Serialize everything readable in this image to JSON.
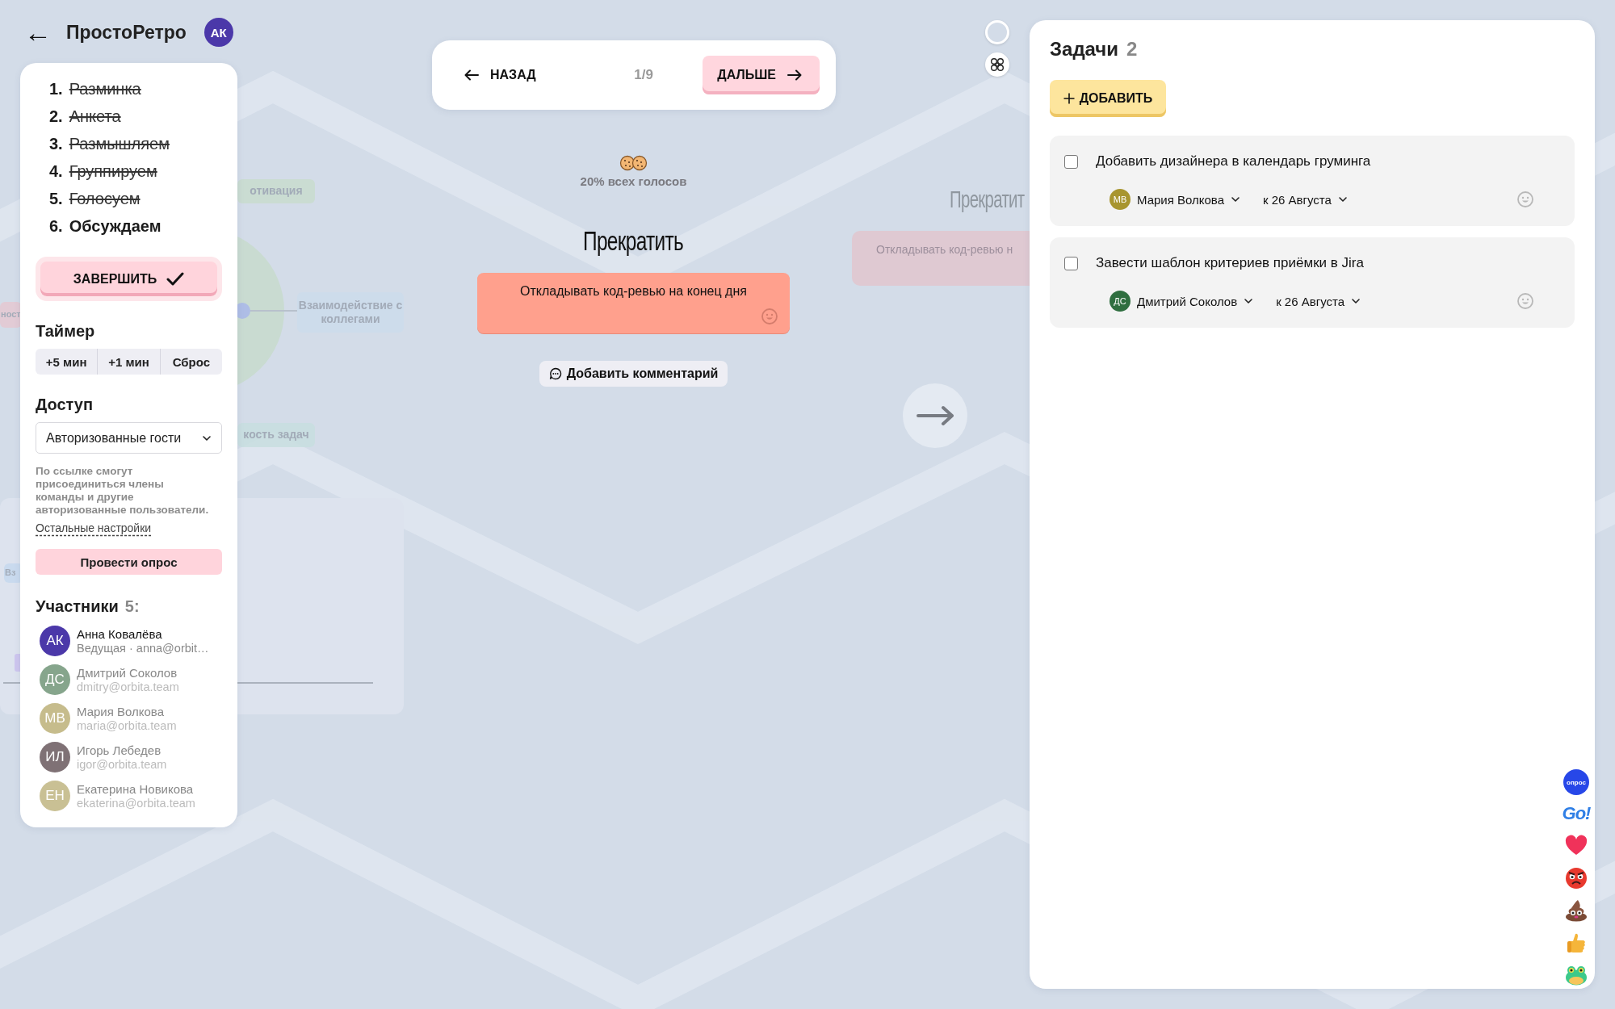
{
  "header": {
    "back_label": "←",
    "title": "ПростоРетро",
    "avatar": "АК"
  },
  "stages": [
    {
      "number": "1.",
      "label": "Разминка",
      "done": true
    },
    {
      "number": "2.",
      "label": "Анкета",
      "done": true
    },
    {
      "number": "3.",
      "label": "Размышляем",
      "done": true
    },
    {
      "number": "4.",
      "label": "Группируем",
      "done": true
    },
    {
      "number": "5.",
      "label": "Голосуем",
      "done": true
    },
    {
      "number": "6.",
      "label": "Обсуждаем",
      "done": false
    }
  ],
  "finish_button": "ЗАВЕРШИТЬ",
  "timer": {
    "title": "Таймер",
    "buttons": [
      "+5 мин",
      "+1 мин",
      "Сброс"
    ]
  },
  "access": {
    "title": "Доступ",
    "value": "Авторизованные гости",
    "hint": "По ссылке смогут присоединиться члены команды и другие авторизованные пользователи.",
    "settings_link": "Остальные настройки"
  },
  "poll_button": "Провести опрос",
  "participants": {
    "title": "Участники",
    "count": "5:",
    "items": [
      {
        "initials": "АК",
        "name": "Анна Ковалёва",
        "detail": "Ведущая · anna@orbit…",
        "color": "#4b38a9",
        "active": true
      },
      {
        "initials": "ДС",
        "name": "Дмитрий Соколов",
        "detail": "dmitry@orbita.team",
        "color": "#86a58c",
        "active": false
      },
      {
        "initials": "МВ",
        "name": "Мария Волкова",
        "detail": "maria@orbita.team",
        "color": "#c6bc8c",
        "active": false
      },
      {
        "initials": "ИЛ",
        "name": "Игорь Лебедев",
        "detail": "igor@orbita.team",
        "color": "#7f7175",
        "active": false
      },
      {
        "initials": "ЕН",
        "name": "Екатерина Новикова",
        "detail": "ekaterina@orbita.team",
        "color": "#c9c094",
        "active": false
      }
    ]
  },
  "navigation": {
    "back": "НАЗАД",
    "progress": "1/9",
    "next": "ДАЛЬШЕ"
  },
  "focus_card": {
    "votes": "20% всех голосов",
    "column": "Прекратить",
    "text": "Откладывать код-ревью на конец дня",
    "comment_button": "Добавить комментарий"
  },
  "background_canvas": {
    "labels": [
      {
        "text": "отивация",
        "color": "#c9dccf"
      },
      {
        "text": "Взаимодействие с коллегами",
        "color": "#cddcec"
      },
      {
        "text": "кость задач",
        "color": "#c8dfe0"
      },
      {
        "text": "ност",
        "color": "#e5c9d2"
      },
      {
        "text": "Вз",
        "color": "#c6d9ee"
      }
    ],
    "next_column": "Прекратит",
    "next_card": "Откладывать код-ревью н"
  },
  "tasks": {
    "title": "Задачи",
    "count": "2",
    "add_button": "ДОБАВИТЬ",
    "items": [
      {
        "text": "Добавить дизайнера в календарь груминга",
        "checked": false,
        "assignee": {
          "initials": "МВ",
          "name": "Мария Волкова",
          "color": "#a8952f"
        },
        "due": "к 26 Августа"
      },
      {
        "text": "Завести шаблон критериев приёмки в Jira",
        "checked": false,
        "assignee": {
          "initials": "ДС",
          "name": "Дмитрий Соколов",
          "color": "#2f6e3f"
        },
        "due": "к 26 Августа"
      }
    ]
  },
  "reactions": [
    {
      "kind": "badge",
      "label": "опрос"
    },
    {
      "kind": "go",
      "label": "Go!"
    },
    {
      "kind": "heart"
    },
    {
      "kind": "angry"
    },
    {
      "kind": "poop"
    },
    {
      "kind": "thumb"
    },
    {
      "kind": "frog"
    }
  ]
}
